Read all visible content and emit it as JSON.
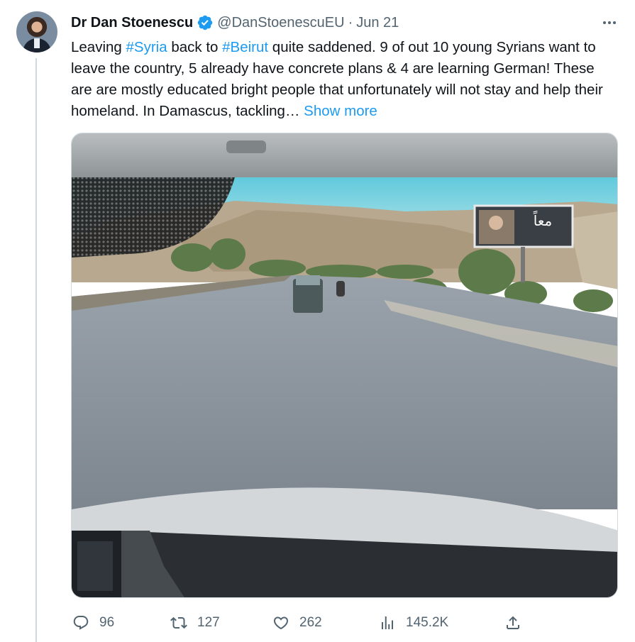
{
  "author": {
    "display_name": "Dr Dan Stoenescu",
    "handle": "@DanStoenescuEU",
    "separator": "·",
    "date": "Jun 21",
    "verified_icon": "verified-badge-icon"
  },
  "tweet": {
    "text_parts": {
      "p1": "Leaving ",
      "hashtag1": "#Syria",
      "p2": " back to ",
      "hashtag2": "#Beirut",
      "p3": " quite saddened. 9 of out 10 young Syrians want to leave the country, 5 already have concrete plans & 4 are learning German! These are are mostly educated bright people that unfortunately will not stay and help their homeland. In Damascus, tackling… ",
      "show_more": "Show more"
    },
    "media": {
      "billboard_text": "معاً"
    }
  },
  "actions": {
    "reply_count": "96",
    "retweet_count": "127",
    "like_count": "262",
    "views_count": "145.2K"
  },
  "colors": {
    "link": "#1d9bf0",
    "secondary_text": "#536471",
    "primary_text": "#0f1419",
    "thread_line": "#cfd9de"
  }
}
